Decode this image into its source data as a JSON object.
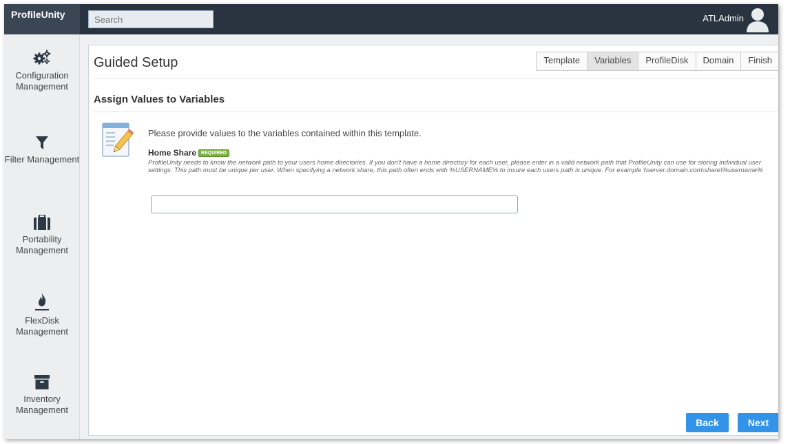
{
  "app": {
    "brand": "ProfileUnity"
  },
  "search": {
    "placeholder": "Search"
  },
  "user": {
    "name": "ATLAdmin"
  },
  "sidebar": {
    "items": [
      {
        "label": "Configuration Management",
        "icon": "gears-icon"
      },
      {
        "label": "Filter Management",
        "icon": "funnel-icon"
      },
      {
        "label": "Portability Management",
        "icon": "suitcase-icon"
      },
      {
        "label": "FlexDisk Management",
        "icon": "flame-icon"
      },
      {
        "label": "Inventory Management",
        "icon": "archive-box-icon"
      }
    ]
  },
  "main": {
    "title": "Guided Setup",
    "tabs": [
      {
        "label": "Template",
        "active": false
      },
      {
        "label": "Variables",
        "active": true
      },
      {
        "label": "ProfileDisk",
        "active": false
      },
      {
        "label": "Domain",
        "active": false
      },
      {
        "label": "Finish",
        "active": false
      }
    ],
    "section_title": "Assign Values to Variables",
    "intro": "Please provide values to the variables contained within this template.",
    "field": {
      "label": "Home Share",
      "badge": "REQUIRED",
      "help": "ProfileUnity needs to know the network path to your users home directories. If you don't have a home directory for each user, please enter in a valid network path that ProfileUnity can use for storing individual user settings. This path must be unique per user. When specifying a network share, this path often ends with %USERNAME% to insure each users path is unique. For example \\\\server.domain.com\\share\\%username%",
      "value": ""
    },
    "buttons": {
      "back": "Back",
      "next": "Next"
    }
  },
  "colors": {
    "topbar": "#2a3440",
    "accent": "#3393e8",
    "required": "#7cb342"
  }
}
